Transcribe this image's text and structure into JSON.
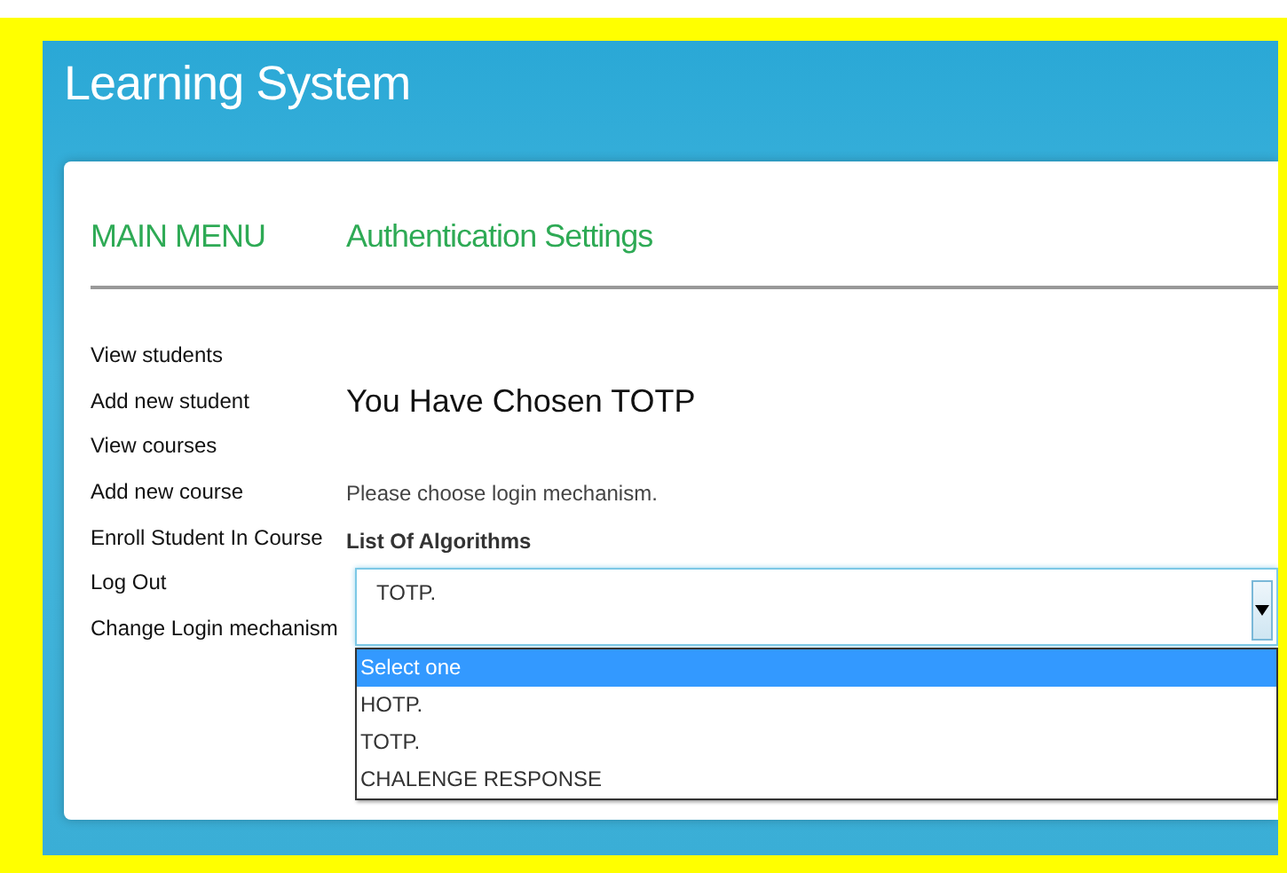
{
  "header": {
    "title": "Learning System"
  },
  "sidebar": {
    "title": "MAIN MENU",
    "items": [
      "View students",
      "Add new student",
      "View courses",
      "Add new course",
      "Enroll Student In Course",
      "Log Out",
      "Change Login mechanism"
    ]
  },
  "main": {
    "title": "Authentication Settings",
    "heading": "You Have Chosen TOTP",
    "instruction": "Please choose login mechanism.",
    "label": "List Of Algorithms",
    "select": {
      "value": "TOTP.",
      "expanded": true,
      "options": [
        {
          "label": "Select one",
          "highlighted": true
        },
        {
          "label": "HOTP.",
          "highlighted": false
        },
        {
          "label": "TOTP.",
          "highlighted": false
        },
        {
          "label": "CHALENGE RESPONSE",
          "highlighted": false
        }
      ]
    }
  }
}
